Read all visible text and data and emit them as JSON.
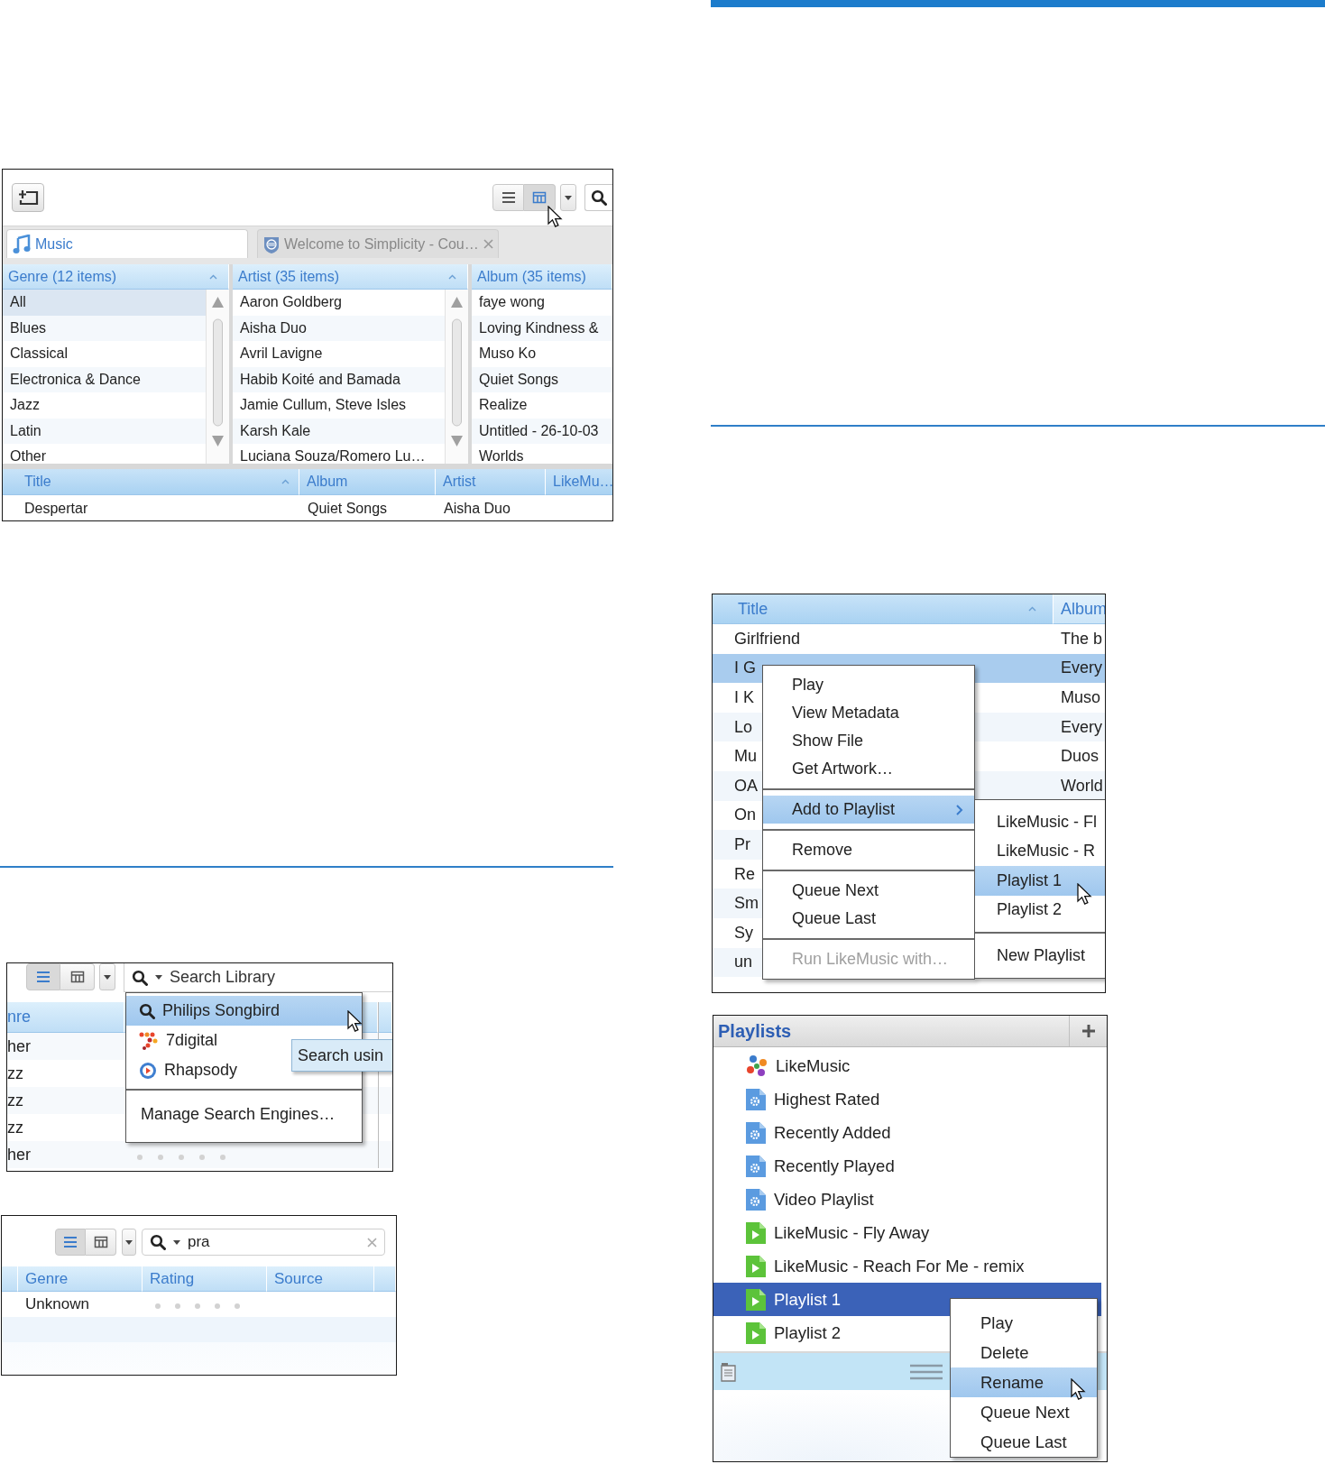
{
  "music_browser": {
    "view_buttons": [
      {
        "kind": "list",
        "selected": false
      },
      {
        "kind": "columns",
        "selected": true
      }
    ],
    "tabs": [
      {
        "label": "Music",
        "selected": true,
        "closable": false
      },
      {
        "label": "Welcome to Simplicity - Cou…",
        "selected": false,
        "closable": true
      }
    ],
    "filter_panes": [
      {
        "header": "Genre (12 items)",
        "sorted": true,
        "scrollbar": true,
        "rows": [
          {
            "text": "All",
            "selected": true
          },
          {
            "text": "Blues",
            "selected": false
          },
          {
            "text": "Classical",
            "selected": false
          },
          {
            "text": "Electronica & Dance",
            "selected": false
          },
          {
            "text": "Jazz",
            "selected": false
          },
          {
            "text": "Latin",
            "selected": false
          },
          {
            "text": "Other",
            "selected": false
          }
        ]
      },
      {
        "header": "Artist (35 items)",
        "sorted": true,
        "scrollbar": true,
        "rows": [
          {
            "text": "Aaron Goldberg",
            "selected": false
          },
          {
            "text": "Aisha Duo",
            "selected": false
          },
          {
            "text": "Avril Lavigne",
            "selected": false
          },
          {
            "text": "Habib Koité and Bamada",
            "selected": false
          },
          {
            "text": "Jamie Cullum, Steve Isles",
            "selected": false
          },
          {
            "text": "Karsh Kale",
            "selected": false
          },
          {
            "text": "Luciana Souza/Romero Lu…",
            "selected": false
          }
        ]
      },
      {
        "header": "Album (35 items)",
        "sorted": false,
        "scrollbar": false,
        "rows": [
          {
            "text": "faye wong",
            "selected": false
          },
          {
            "text": "Loving Kindness &",
            "selected": false
          },
          {
            "text": "Muso Ko",
            "selected": false
          },
          {
            "text": "Quiet Songs",
            "selected": false
          },
          {
            "text": "Realize",
            "selected": false
          },
          {
            "text": "Untitled - 26-10-03",
            "selected": false
          },
          {
            "text": "Worlds",
            "selected": false
          }
        ]
      }
    ],
    "track_table": {
      "columns": [
        {
          "label": "Title",
          "sorted": true
        },
        {
          "label": "Album",
          "sorted": false
        },
        {
          "label": "Artist",
          "sorted": false
        },
        {
          "label": "LikeMu…",
          "sorted": false
        }
      ],
      "rows": [
        {
          "title": "Despertar",
          "album": "Quiet Songs",
          "artist": "Aisha Duo"
        }
      ]
    }
  },
  "search_menu_view": {
    "view_buttons": [
      {
        "kind": "list",
        "selected": true
      },
      {
        "kind": "columns",
        "selected": false
      }
    ],
    "search": {
      "placeholder": "Search Library"
    },
    "column_header": "nre",
    "rows": [
      {
        "text": "her"
      },
      {
        "text": "zz"
      },
      {
        "text": "zz"
      },
      {
        "text": "zz"
      },
      {
        "text": "her",
        "stars": 0
      }
    ],
    "engine_menu": [
      {
        "label": "Philips Songbird",
        "kind": "engine",
        "selected": true
      },
      {
        "label": "7digital",
        "kind": "engine",
        "selected": false
      },
      {
        "label": "Rhapsody",
        "kind": "engine",
        "selected": false
      },
      {
        "label": "Manage Search Engines…",
        "kind": "command",
        "selected": false
      }
    ],
    "tooltip": "Search usin"
  },
  "search_results_view": {
    "view_buttons": [
      {
        "kind": "list",
        "selected": true
      },
      {
        "kind": "columns",
        "selected": false
      }
    ],
    "search": {
      "value": "pra"
    },
    "columns": [
      "Genre",
      "Rating",
      "Source"
    ],
    "rows": [
      {
        "genre": "Unknown",
        "stars": 0
      }
    ]
  },
  "track_menu_view": {
    "columns": [
      {
        "label": "Title",
        "sorted": true
      },
      {
        "label": "Album",
        "sorted": false
      }
    ],
    "rows": [
      {
        "title": "Girlfriend",
        "album": "The b",
        "selected": false
      },
      {
        "title": "I G",
        "album": "Every",
        "selected": true
      },
      {
        "title": "I K",
        "album": "Muso",
        "selected": false
      },
      {
        "title": "Lo",
        "album": "Every",
        "selected": false
      },
      {
        "title": "Mu",
        "album": "Duos",
        "selected": false
      },
      {
        "title": "OA",
        "album": "World",
        "selected": false
      },
      {
        "title": "On",
        "selected": false
      },
      {
        "title": "Pr",
        "selected": false
      },
      {
        "title": "Re",
        "selected": false
      },
      {
        "title": "Sm",
        "selected": false
      },
      {
        "title": "Sy",
        "selected": false
      },
      {
        "title": "un",
        "selected": false
      }
    ],
    "context_menu": [
      [
        {
          "label": "Play",
          "selected": false,
          "disabled": false
        },
        {
          "label": "View Metadata",
          "selected": false,
          "disabled": false
        },
        {
          "label": "Show File",
          "selected": false,
          "disabled": false
        },
        {
          "label": "Get Artwork…",
          "selected": false,
          "disabled": false
        }
      ],
      [
        {
          "label": "Add to Playlist",
          "selected": true,
          "disabled": false,
          "submenu": true
        }
      ],
      [
        {
          "label": "Remove",
          "selected": false,
          "disabled": false
        }
      ],
      [
        {
          "label": "Queue Next",
          "selected": false,
          "disabled": false
        },
        {
          "label": "Queue Last",
          "selected": false,
          "disabled": false
        }
      ],
      [
        {
          "label": "Run LikeMusic with…",
          "selected": false,
          "disabled": true
        }
      ]
    ],
    "submenu": [
      [
        {
          "label": "LikeMusic - Fl",
          "selected": false
        },
        {
          "label": "LikeMusic - R",
          "selected": false
        },
        {
          "label": "Playlist 1",
          "selected": true
        },
        {
          "label": "Playlist 2",
          "selected": false
        }
      ],
      [
        {
          "label": "New Playlist",
          "selected": false
        }
      ]
    ]
  },
  "playlists_view": {
    "title": "Playlists",
    "items": [
      {
        "label": "LikeMusic",
        "kind": "likemusic",
        "selected": false
      },
      {
        "label": "Highest Rated",
        "kind": "smart",
        "selected": false
      },
      {
        "label": "Recently Added",
        "kind": "smart",
        "selected": false
      },
      {
        "label": "Recently Played",
        "kind": "smart",
        "selected": false
      },
      {
        "label": "Video Playlist",
        "kind": "smart",
        "selected": false
      },
      {
        "label": "LikeMusic - Fly Away",
        "kind": "playlist",
        "selected": false
      },
      {
        "label": "LikeMusic - Reach For Me - remix",
        "kind": "playlist",
        "selected": false
      },
      {
        "label": "Playlist 1",
        "kind": "playlist",
        "selected": true
      },
      {
        "label": "Playlist 2",
        "kind": "playlist",
        "selected": false
      }
    ],
    "context_menu": [
      {
        "label": "Play",
        "selected": false
      },
      {
        "label": "Delete",
        "selected": false
      },
      {
        "label": "Rename",
        "selected": true
      },
      {
        "label": "Queue Next",
        "selected": false
      },
      {
        "label": "Queue Last",
        "selected": false
      }
    ]
  }
}
